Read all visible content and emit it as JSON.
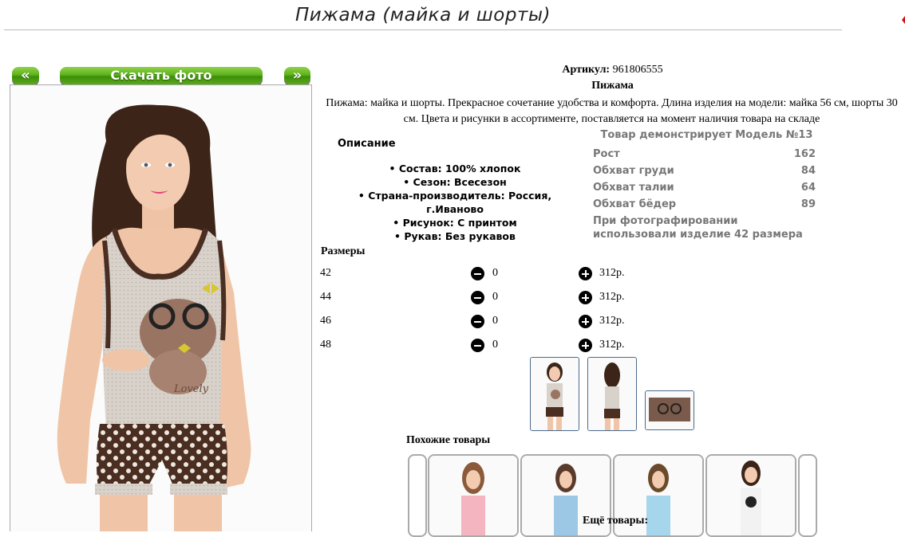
{
  "page": {
    "title": "Пижама (майка и шорты)"
  },
  "buttons": {
    "prev": "«",
    "download": "Скачать фото",
    "next": "»"
  },
  "product": {
    "sku_label": "Артикул:",
    "sku_value": "961806555",
    "type": "Пижама",
    "description": "Пижама: майка и шорты. Прекрасное сочетание удобства и комфорта. Длина изделия на модели: майка 56 см, шорты 30 см. Цвета и рисунки в ассортименте, поставляется на момент наличия товара на складе"
  },
  "details": {
    "heading": "Описание",
    "attributes": [
      "Состав: 100% хлопок",
      "Сезон: Всесезон",
      "Страна-производитель: Россия, г.Иваново",
      "Рисунок: С принтом",
      "Рукав: Без рукавов"
    ]
  },
  "model": {
    "heading": "Товар демонстрирует Модель №13",
    "rows": [
      {
        "label": "Рост",
        "value": "162"
      },
      {
        "label": "Обхват груди",
        "value": "84"
      },
      {
        "label": "Обхват талии",
        "value": "64"
      },
      {
        "label": "Обхват бёдер",
        "value": "89"
      }
    ],
    "note": "При фотографировании использовали изделие 42 размера"
  },
  "sizes": {
    "heading": "Размеры",
    "rows": [
      {
        "size": "42",
        "qty": "0",
        "price": "312р."
      },
      {
        "size": "44",
        "qty": "0",
        "price": "312р."
      },
      {
        "size": "46",
        "qty": "0",
        "price": "312р."
      },
      {
        "size": "48",
        "qty": "0",
        "price": "312р."
      }
    ]
  },
  "similar": {
    "heading": "Похожие товары"
  },
  "more": {
    "heading": "Ещё товары:"
  },
  "colors": {
    "button_green": "#5fb21d",
    "polka_brown": "#4a2e22",
    "top_gray": "#dcd6cf"
  }
}
